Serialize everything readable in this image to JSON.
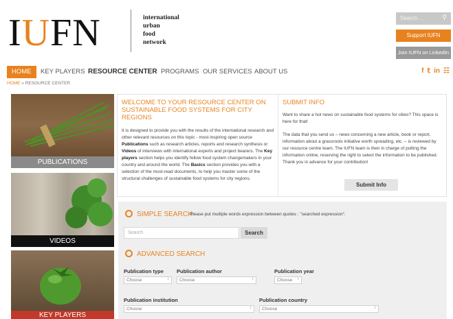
{
  "logo": {
    "part1": "I",
    "part2": "U",
    "part3": "FN"
  },
  "tagline": [
    "international",
    "urban",
    "food",
    "network"
  ],
  "top_right": {
    "search_placeholder": "Search ...",
    "support_label": "Support IUFN",
    "linkedin_label": "Join IUFN on LinkedIn"
  },
  "nav": {
    "items": [
      "HOME",
      "KEY PLAYERS",
      "RESOURCE CENTER",
      "PROGRAMS",
      "OUR SERVICES",
      "ABOUT US"
    ]
  },
  "socials": [
    "f",
    "t",
    "in",
    "rss"
  ],
  "breadcrumb": {
    "home": "HOME",
    "sep": " » ",
    "current": "RESOURCE CENTER"
  },
  "tiles": [
    "PUBLICATIONS",
    "VIDEOS",
    "KEY PLAYERS"
  ],
  "welcome": {
    "title": "WELCOME TO YOUR RESOURCE CENTER ON SUSTAINABLE FOOD SYSTEMS FOR CITY REGIONS",
    "p1": "It is designed to provide you with the results of the international research and other relevant resources on this topic - most inspiring open source ",
    "b1": "Publications",
    "p2": " such as research articles, reports and research synthesis or ",
    "b2": "Videos",
    "p3": " of interviews with international experts and project bearers. The ",
    "b3": "Key players",
    "p4": " section helps you identify fellow food system changemakers in your country and around the world. The ",
    "b4": "Basics",
    "p5": " section provides you with a selection of the must-read documents, to help you master some of the structural challenges of sustainable food systems for city regions."
  },
  "submit": {
    "title": "SUBMIT INFO",
    "p1": "Want to share a hot news on sustainable food systems for cities? This space is here for that!",
    "p2": "The data that you send us – news concerning a new article, book or report, information about a grassroots initiative worth spreading, etc. – is reviewed by our resource centre team. The IUFN team is then in charge of putting the information online, reserving the right to select the information to be published. Thank you in advance for your contribution!",
    "button": "Submit Info"
  },
  "simple_search": {
    "title": "SIMPLE SEARCH",
    "hint": "Please put multiple words expression between quotes : \"searched expression\".",
    "placeholder": "Search",
    "button": "Search"
  },
  "advanced_search": {
    "title": "ADVANCED SEARCH",
    "type_label": "Publication type",
    "author_label": "Publication author",
    "year_label": "Publication year",
    "institution_label": "Publication institution",
    "country_label": "Publication country",
    "choose": "Choose"
  },
  "colors": {
    "accent": "#e8821e",
    "gray_button": "#9a9a9a",
    "panel_bg": "#efefef"
  }
}
